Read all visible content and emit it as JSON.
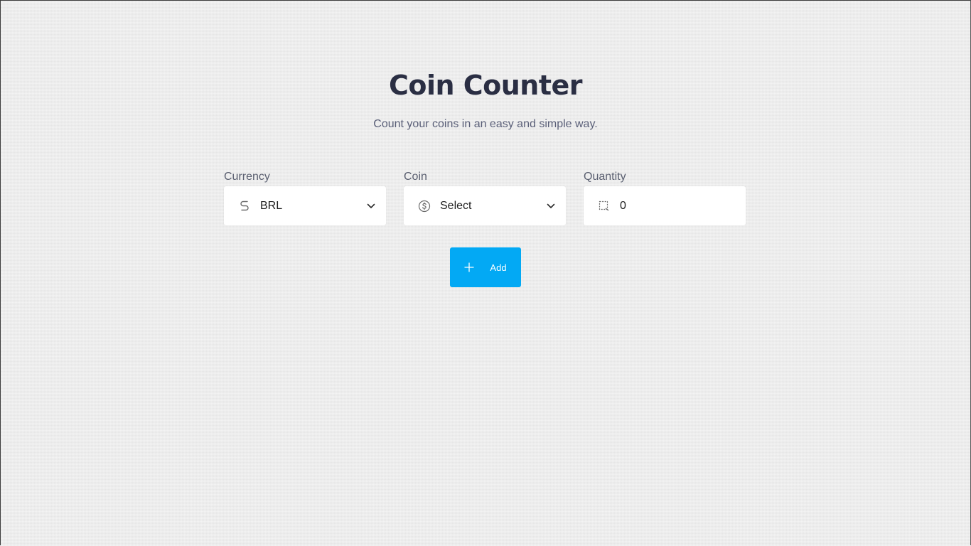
{
  "header": {
    "title": "Coin Counter",
    "subtitle": "Count your coins in an easy and simple way."
  },
  "form": {
    "currency": {
      "label": "Currency",
      "value": "BRL",
      "icon": "currency-s-icon"
    },
    "coin": {
      "label": "Coin",
      "value": "Select",
      "icon": "coin-dollar-icon"
    },
    "quantity": {
      "label": "Quantity",
      "value": "0",
      "icon": "dashed-square-icon"
    },
    "add_button": {
      "label": "Add",
      "icon": "plus-icon"
    }
  },
  "colors": {
    "accent": "#03a9f4",
    "title": "#2a2e43",
    "background": "#ececec"
  }
}
